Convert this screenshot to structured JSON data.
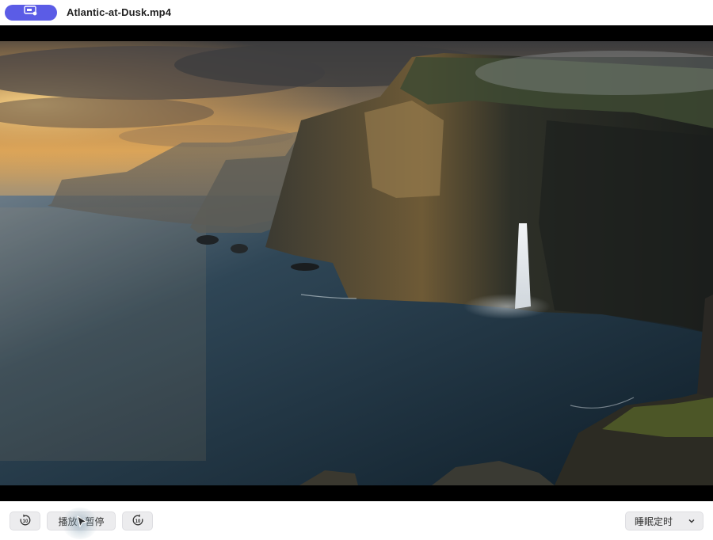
{
  "window": {
    "title": "Atlantic-at-Dusk.mp4"
  },
  "video": {
    "scene": "sea cliffs at dusk with waterfall"
  },
  "controls": {
    "rewind_label": "10",
    "play_pause_label": "播放 / 暂停",
    "forward_label": "10",
    "sleep_timer_label": "睡眠定时"
  },
  "colors": {
    "accent": "#5b5ce6",
    "button_bg": "#ececee"
  },
  "icons": {
    "screen_button": "screen-share-icon",
    "rewind": "rewind-10-icon",
    "forward": "forward-10-icon",
    "sleep_dropdown": "chevron-down-icon"
  }
}
